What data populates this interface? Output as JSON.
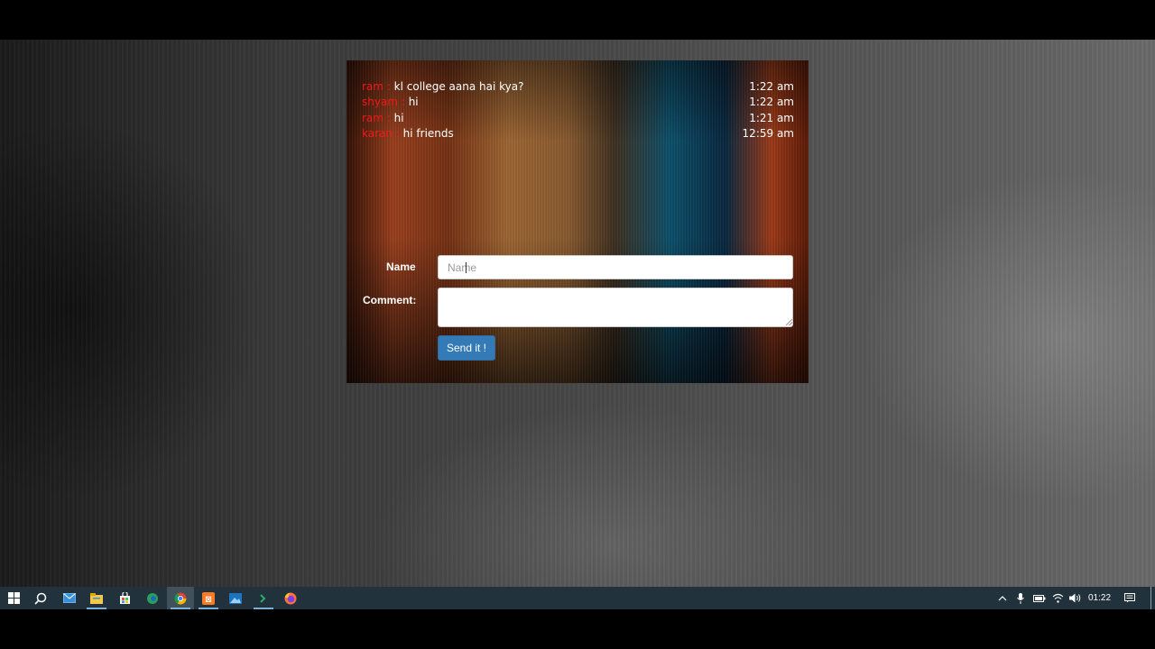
{
  "chat": {
    "messages": [
      {
        "name": "ram",
        "sep": " : ",
        "text": "kl college aana hai kya?",
        "time": "1:22 am"
      },
      {
        "name": "shyam",
        "sep": " : ",
        "text": "hi",
        "time": "1:22 am"
      },
      {
        "name": "ram",
        "sep": " : ",
        "text": "hi",
        "time": "1:21 am"
      },
      {
        "name": "karan",
        "sep": " : ",
        "text": "hi friends",
        "time": "12:59 am"
      }
    ]
  },
  "form": {
    "name_label": "Name",
    "name_placeholder": "Name",
    "comment_label": "Comment:",
    "submit_label": "Send it !"
  },
  "taskbar": {
    "clock": "01:22",
    "icons": [
      "windows-start-icon",
      "search-icon",
      "mail-icon",
      "file-explorer-icon",
      "store-icon",
      "edge-icon",
      "chrome-icon",
      "xampp-icon",
      "photos-icon",
      "terminal-icon",
      "firefox-icon"
    ]
  },
  "colors": {
    "name_color": "#ee1a1a",
    "button_color": "#337ab7",
    "taskbar_color": "#22323c"
  }
}
